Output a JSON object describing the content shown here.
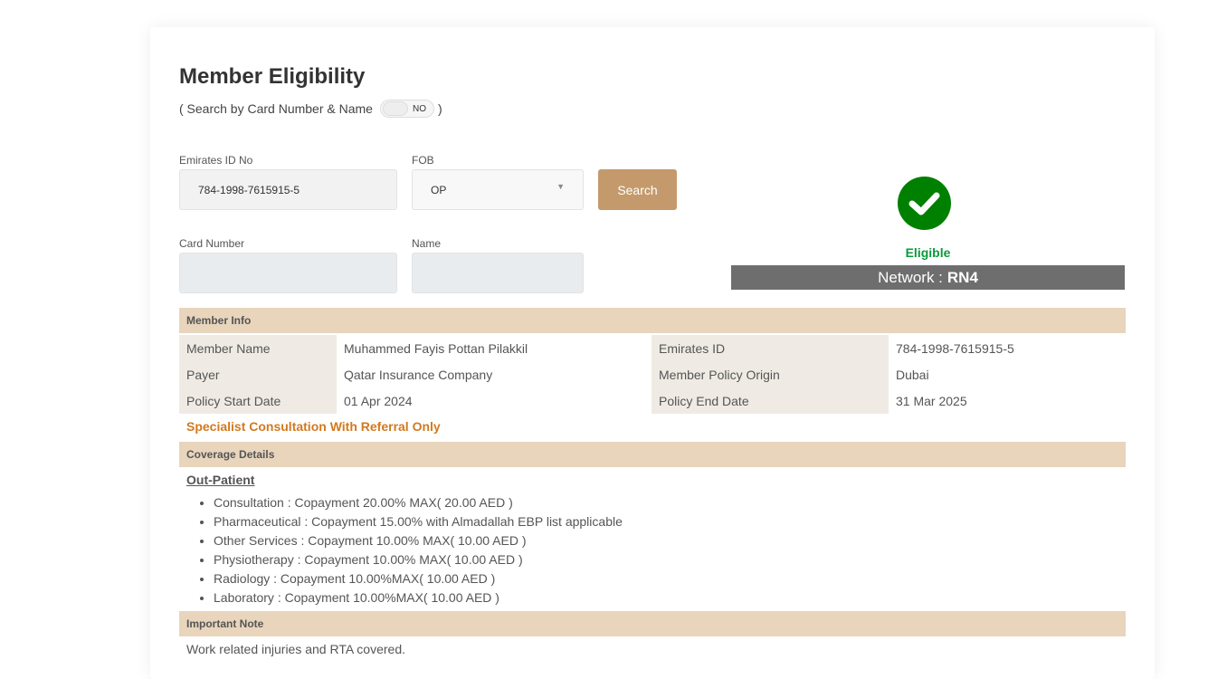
{
  "title": "Member Eligibility",
  "search_toggle": {
    "prefix": "( Search by Card Number & Name",
    "state": "NO",
    "suffix": ")"
  },
  "form": {
    "emirates_id": {
      "label": "Emirates ID No",
      "value": "784-1998-7615915-5"
    },
    "fob": {
      "label": "FOB",
      "value": "OP"
    },
    "search_label": "Search",
    "card_number": {
      "label": "Card Number",
      "value": ""
    },
    "name": {
      "label": "Name",
      "value": ""
    }
  },
  "status": {
    "label": "Eligible",
    "network_prefix": "Network :",
    "network": "RN4",
    "color": "#008000"
  },
  "member_info": {
    "header": "Member Info",
    "rows": [
      {
        "l1": "Member Name",
        "v1": "Muhammed Fayis Pottan Pilakkil",
        "l2": "Emirates ID",
        "v2": "784-1998-7615915-5"
      },
      {
        "l1": "Payer",
        "v1": "Qatar Insurance Company",
        "l2": "Member Policy Origin",
        "v2": "Dubai"
      },
      {
        "l1": "Policy Start Date",
        "v1": "01 Apr 2024",
        "l2": "Policy End Date",
        "v2": "31 Mar 2025"
      }
    ],
    "warning": "Specialist Consultation With Referral Only"
  },
  "coverage": {
    "header": "Coverage Details",
    "section": "Out-Patient",
    "items": [
      "Consultation : Copayment 20.00% MAX( 20.00 AED )",
      "Pharmaceutical : Copayment 15.00% with Almadallah EBP list applicable",
      "Other Services : Copayment 10.00% MAX( 10.00 AED )",
      "Physiotherapy : Copayment 10.00% MAX( 10.00 AED )",
      "Radiology : Copayment 10.00%MAX( 10.00 AED )",
      "Laboratory : Copayment 10.00%MAX( 10.00 AED )"
    ]
  },
  "note": {
    "header": "Important Note",
    "text": "Work related injuries and RTA covered."
  }
}
